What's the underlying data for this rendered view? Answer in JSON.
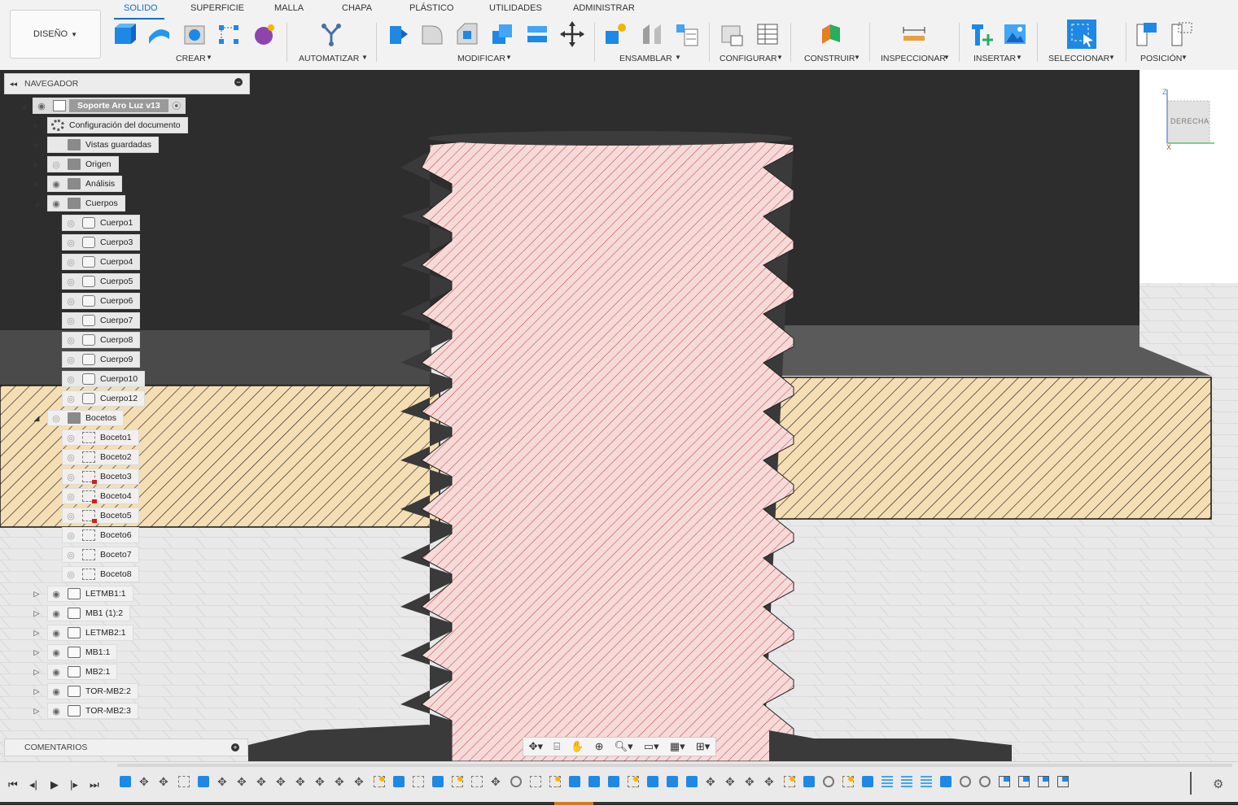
{
  "toolbar": {
    "workspace": "DISEÑO",
    "tabs": [
      "SOLIDO",
      "SUPERFICIE",
      "MALLA",
      "CHAPA",
      "PLÁSTICO",
      "UTILIDADES",
      "ADMINISTRAR"
    ],
    "active_tab": "SOLIDO",
    "groups": [
      "CREAR",
      "AUTOMATIZAR",
      "MODIFICAR",
      "ENSAMBLAR",
      "CONFIGURAR",
      "CONSTRUIR",
      "INSPECCIONAR",
      "INSERTAR",
      "SELECCIONAR",
      "POSICIÓN"
    ]
  },
  "browser": {
    "title": "NAVEGADOR",
    "root": "Soporte Aro Luz v13",
    "top_items": [
      "Configuración del documento",
      "Vistas guardadas",
      "Origen",
      "Análisis",
      "Cuerpos"
    ],
    "bodies": [
      "Cuerpo1",
      "Cuerpo3",
      "Cuerpo4",
      "Cuerpo5",
      "Cuerpo6",
      "Cuerpo7",
      "Cuerpo8",
      "Cuerpo9",
      "Cuerpo10",
      "Cuerpo12"
    ],
    "sketches_folder": "Bocetos",
    "sketches": [
      "Boceto1",
      "Boceto2",
      "Boceto3",
      "Boceto4",
      "Boceto5",
      "Boceto6",
      "Boceto7",
      "Boceto8"
    ],
    "components": [
      "LETMB1:1",
      "MB1 (1):2",
      "LETMB2:1",
      "MB1:1",
      "MB2:1",
      "TOR-MB2:2",
      "TOR-MB2:3"
    ],
    "comments": "COMENTARIOS"
  },
  "viewcube": {
    "face": "DERECHA",
    "axis_z": "Z",
    "axis_x": "X"
  },
  "colors": {
    "accent": "#0a70c8",
    "section_pink": "#f6dada",
    "section_hatch_red": "#c0392b",
    "section_tan": "#f5deb3",
    "dark_body": "#2d2d2d"
  },
  "icons": {
    "eye": "eye-icon",
    "folder": "folder-icon",
    "body": "body-icon",
    "sketch": "sketch-icon",
    "component": "component-icon"
  }
}
